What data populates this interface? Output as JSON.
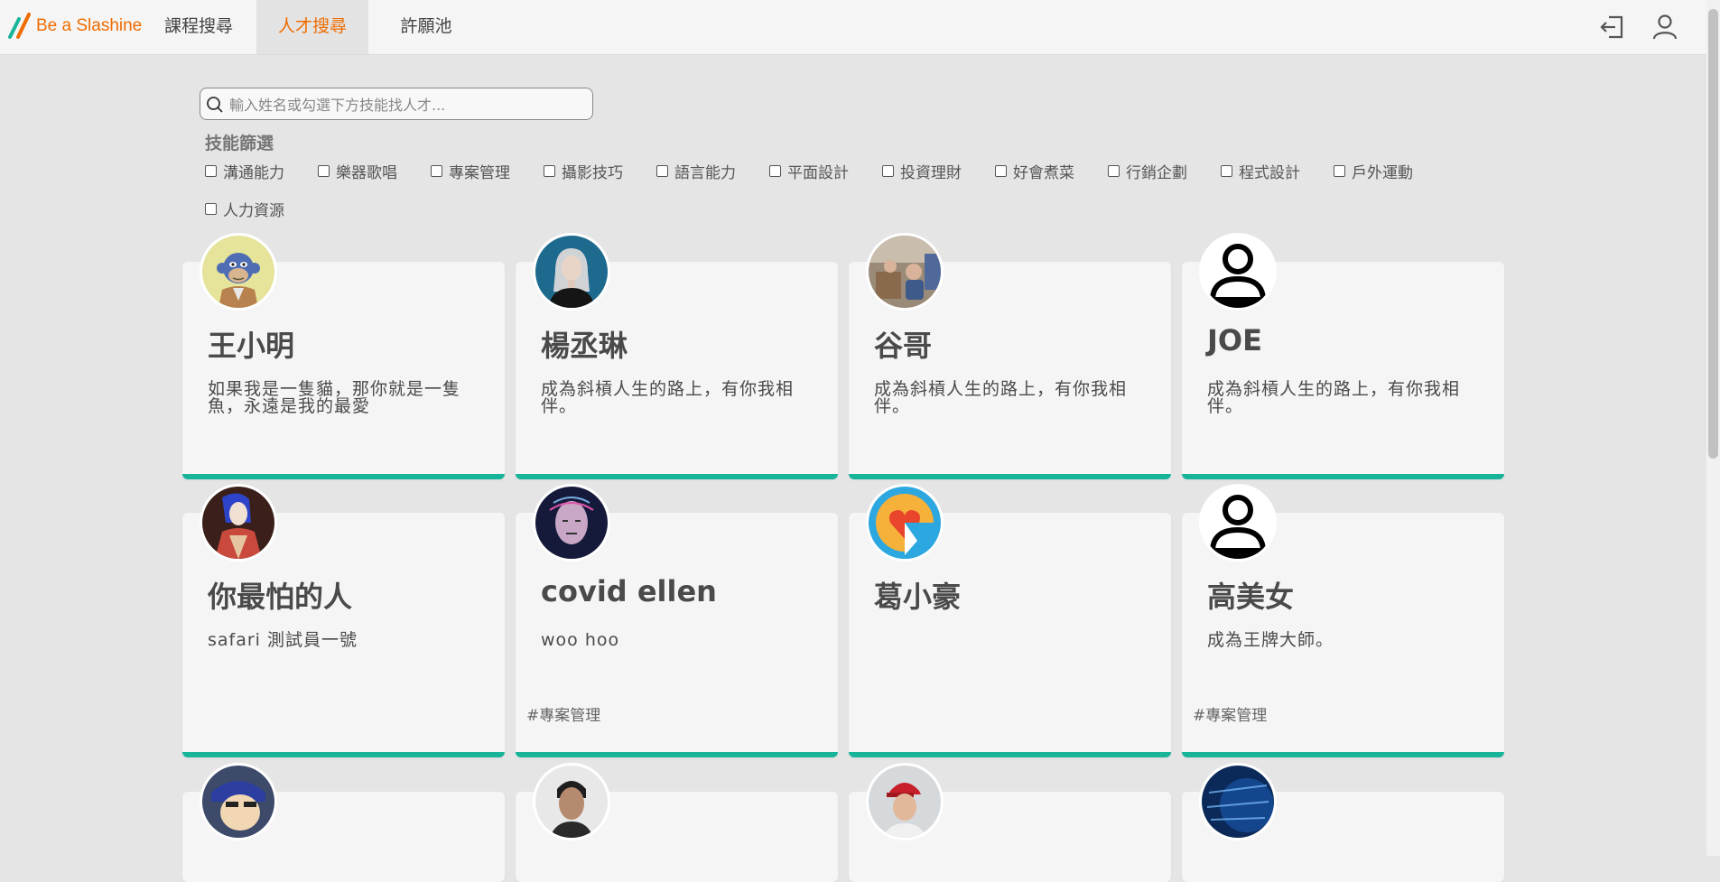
{
  "brand": {
    "logo_text": "Be a Slashine"
  },
  "nav": {
    "tabs": [
      "課程搜尋",
      "人才搜尋",
      "許願池"
    ]
  },
  "search": {
    "placeholder": "輸入姓名或勾選下方技能找人才..."
  },
  "skills": {
    "title": "技能篩選",
    "options": [
      "溝通能力",
      "樂器歌唱",
      "專案管理",
      "攝影技巧",
      "語言能力",
      "平面設計",
      "投資理財",
      "好會煮菜",
      "行銷企劃",
      "程式設計",
      "戶外運動",
      "人力資源"
    ]
  },
  "cards": [
    {
      "name": "王小明",
      "intro": "如果我是一隻貓，那你就是一隻魚，永遠是我的最愛",
      "tag": "",
      "avatar": "ape-avatar"
    },
    {
      "name": "楊丞琳",
      "intro": "成為斜槓人生的路上，有你我相伴。",
      "tag": "",
      "avatar": "woman-photo-avatar"
    },
    {
      "name": "谷哥",
      "intro": "成為斜槓人生的路上，有你我相伴。",
      "tag": "",
      "avatar": "kids-photo-avatar"
    },
    {
      "name": "JOE",
      "intro": "成為斜槓人生的路上，有你我相伴。",
      "tag": "",
      "avatar": "default-user-avatar"
    },
    {
      "name": "你最怕的人",
      "intro": "safari 測試員一號",
      "tag": "",
      "avatar": "illustration-avatar"
    },
    {
      "name": "covid ellen",
      "intro": "woo hoo",
      "tag": "#專案管理",
      "avatar": "abstract-face-avatar"
    },
    {
      "name": "葛小豪",
      "intro": "",
      "tag": "",
      "avatar": "heart-logo-avatar"
    },
    {
      "name": "高美女",
      "intro": "成為王牌大師。",
      "tag": "#專案管理",
      "avatar": "default-user-avatar"
    },
    {
      "name": "",
      "intro": "",
      "tag": "",
      "avatar": "cartoon-avatar"
    },
    {
      "name": "",
      "intro": "",
      "tag": "",
      "avatar": "man-photo-avatar"
    },
    {
      "name": "",
      "intro": "",
      "tag": "",
      "avatar": "baseball-player-avatar"
    },
    {
      "name": "",
      "intro": "",
      "tag": "",
      "avatar": "code-avatar"
    }
  ],
  "colors": {
    "accent": "#ef6c00",
    "card_bar": "#17b49a",
    "page_bg": "#e5e5e5"
  }
}
